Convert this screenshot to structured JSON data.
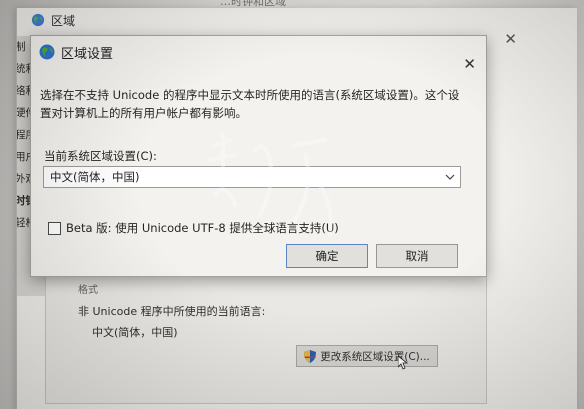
{
  "top_clip_text": "…时钟和区域",
  "region_window": {
    "title": "区域",
    "sidebar_items": [
      "制",
      "统和",
      "络和",
      "硬件和",
      "程序",
      "用户",
      "外观和",
      "时钟和",
      "轻松"
    ],
    "lower_title": "格式",
    "non_unicode_label": "非 Unicode 程序中所使用的当前语言:",
    "current_language": "中文(简体，中国)",
    "change_locale_button": "更改系统区域设置(C)..."
  },
  "dialog": {
    "title": "区域设置",
    "description": "选择在不支持 Unicode 的程序中显示文本时所使用的语言(系统区域设置)。这个设置对计算机上的所有用户帐户都有影响。",
    "locale_label": "当前系统区域设置(C):",
    "locale_value": "中文(简体，中国)",
    "beta_label": "Beta 版: 使用 Unicode UTF-8 提供全球语言支持(U)",
    "beta_checked": false,
    "ok_label": "确定",
    "cancel_label": "取消"
  },
  "icons": {
    "dialog_icon": "globe-icon",
    "button_icon": "uac-shield-icon",
    "close_icon": "close-icon",
    "dropdown_icon": "chevron-down-icon"
  },
  "colors": {
    "accent_border": "#5c86c6",
    "dialog_bg": "#f3f2ef"
  }
}
